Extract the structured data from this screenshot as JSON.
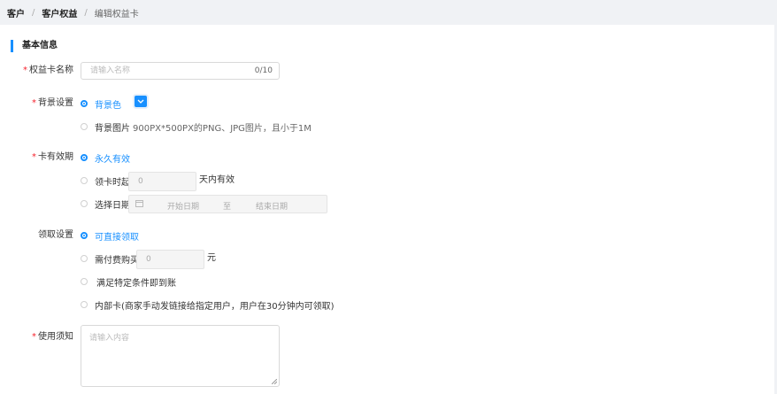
{
  "breadcrumb": [
    {
      "label": "客户"
    },
    {
      "label": "客户权益"
    },
    {
      "label": "编辑权益卡"
    }
  ],
  "section": {
    "title": "基本信息"
  },
  "colors": {
    "accent": "#1890ff",
    "required": "#f5222d"
  },
  "form": {
    "name": {
      "label": "权益卡名称",
      "placeholder": "请输入名称",
      "counter": "0/10"
    },
    "background": {
      "label": "背景设置",
      "option_color": "背景色",
      "option_image": "背景图片",
      "image_hint": "900PX*500PX的PNG、JPG图片，且小于1M",
      "color_picker_icon": "chevron-down-icon"
    },
    "validity": {
      "label": "卡有效期",
      "option_forever": "永久有效",
      "option_days": "领卡时起",
      "days_value": "0",
      "days_suffix": "天内有效",
      "option_range": "选择日期",
      "start_placeholder": "开始日期",
      "range_sep": "至",
      "end_placeholder": "结束日期"
    },
    "claim": {
      "label": "领取设置",
      "option_direct": "可直接领取",
      "option_paid": "需付费购买",
      "paid_value": "0",
      "paid_unit": "元",
      "option_condition": "满足特定条件即到账",
      "option_internal": "内部卡(商家手动发链接给指定用户，用户在30分钟内可领取)"
    },
    "notice": {
      "label": "使用须知",
      "placeholder": "请输入内容"
    }
  }
}
